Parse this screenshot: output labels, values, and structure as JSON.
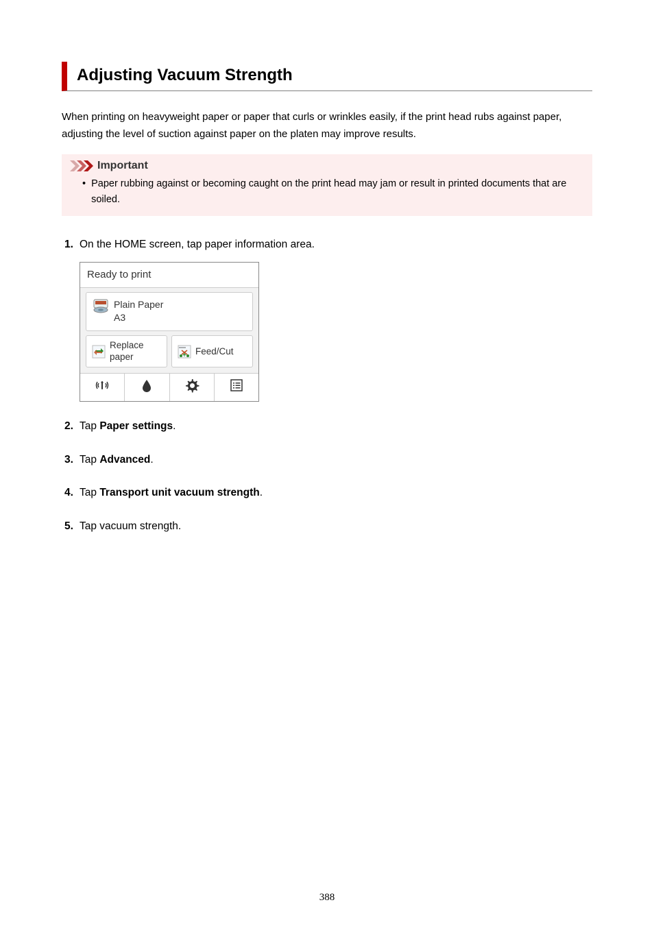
{
  "title": "Adjusting Vacuum Strength",
  "intro": "When printing on heavyweight paper or paper that curls or wrinkles easily, if the print head rubs against paper, adjusting the level of suction against paper on the platen may improve results.",
  "callout": {
    "label": "Important",
    "bullet": "Paper rubbing against or becoming caught on the print head may jam or result in printed documents that are soiled."
  },
  "steps": {
    "s1": {
      "num": "1",
      "pre": "On the HOME screen, tap paper information area."
    },
    "s2": {
      "num": "2",
      "pre": "Tap ",
      "bold": "Paper settings",
      "post": "."
    },
    "s3": {
      "num": "3",
      "pre": "Tap ",
      "bold": "Advanced",
      "post": "."
    },
    "s4": {
      "num": "4",
      "pre": "Tap ",
      "bold": "Transport unit vacuum strength",
      "post": "."
    },
    "s5": {
      "num": "5",
      "pre": "Tap vacuum strength."
    }
  },
  "device": {
    "status": "Ready to print",
    "paper_type": "Plain Paper",
    "paper_size": "A3",
    "replace_label": "Replace paper",
    "feedcut_label": "Feed/Cut"
  },
  "page_number": "388"
}
